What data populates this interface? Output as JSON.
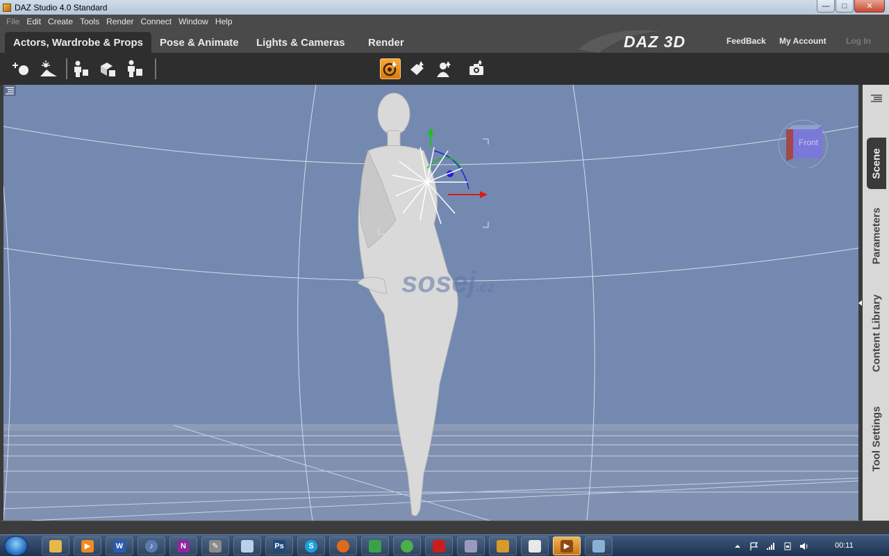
{
  "window": {
    "title": "DAZ Studio 4.0 Standard",
    "minimize": "—",
    "maximize": "□",
    "close": "✕"
  },
  "menu": [
    "File",
    "Edit",
    "Create",
    "Tools",
    "Render",
    "Connect",
    "Window",
    "Help"
  ],
  "tabs": [
    {
      "label": "Actors, Wardrobe & Props",
      "active": true
    },
    {
      "label": "Pose & Animate",
      "active": false
    },
    {
      "label": "Lights & Cameras",
      "active": false
    },
    {
      "label": "Render",
      "active": false
    }
  ],
  "brand": "DAZ 3D",
  "links": {
    "feedback": "FeedBack",
    "account": "My Account",
    "login": "Log In"
  },
  "toolbar": {
    "left": [
      "add-prop-icon",
      "environment-icon",
      "figure-group-icon",
      "props-group-icon",
      "figure-setup-icon"
    ],
    "center": [
      "universal-tool-icon",
      "surface-tool-icon",
      "node-select-icon"
    ],
    "right": [
      "camera-icon"
    ]
  },
  "viewport": {
    "watermark": "sosej",
    "watermark_suffix": ".cz",
    "nav_cube_label": "Front",
    "background": "#7489af"
  },
  "side_tabs": [
    {
      "label": "Scene",
      "active": true
    },
    {
      "label": "Parameters",
      "active": false
    },
    {
      "label": "Content Library",
      "active": false
    },
    {
      "label": "Tool Settings",
      "active": false
    }
  ],
  "taskbar": {
    "apps": [
      "explorer",
      "media-player",
      "W",
      "itunes",
      "N",
      "pen",
      "notepad",
      "Ps",
      "S",
      "firefox",
      "app1",
      "app2",
      "pdf",
      "app3",
      "app4",
      "app5",
      "daz-studio",
      "window"
    ],
    "active_app": "daz-studio",
    "clock": "00:11"
  },
  "colors": {
    "accent": "#e8891a",
    "viewport": "#7489af",
    "panel": "#2e2e2e"
  }
}
